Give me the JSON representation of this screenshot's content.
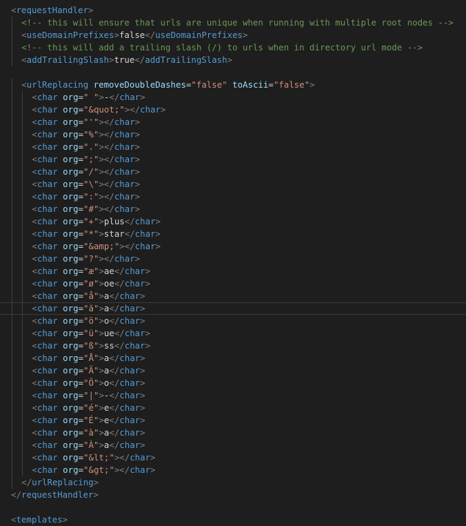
{
  "editor": {
    "theme_colors": {
      "background": "#1e1e1e",
      "tag": "#569cd6",
      "attribute": "#9cdcfe",
      "string": "#ce9178",
      "comment": "#6a9955",
      "text": "#d4d4d4",
      "bracket": "#808080"
    },
    "lines": [
      {
        "indent": 0,
        "type": "open",
        "tag": "requestHandler"
      },
      {
        "indent": 1,
        "type": "comment",
        "text": "<!-- this will ensure that urls are unique when running with multiple root nodes -->"
      },
      {
        "indent": 1,
        "type": "element",
        "tag": "useDomainPrefixes",
        "content": "false"
      },
      {
        "indent": 1,
        "type": "comment",
        "text": "<!-- this will add a trailing slash (/) to urls when in directory url mode -->"
      },
      {
        "indent": 1,
        "type": "element",
        "tag": "addTrailingSlash",
        "content": "true"
      },
      {
        "indent": 0,
        "type": "blank"
      },
      {
        "indent": 1,
        "type": "open",
        "tag": "urlReplacing",
        "attrs": [
          {
            "name": "removeDoubleDashes",
            "value": "false"
          },
          {
            "name": "toAscii",
            "value": "false"
          }
        ]
      },
      {
        "indent": 2,
        "type": "char",
        "org": " ",
        "content": "-"
      },
      {
        "indent": 2,
        "type": "char",
        "org": "&quot;",
        "content": ""
      },
      {
        "indent": 2,
        "type": "char",
        "org": "'",
        "content": ""
      },
      {
        "indent": 2,
        "type": "char",
        "org": "%",
        "content": ""
      },
      {
        "indent": 2,
        "type": "char",
        "org": ".",
        "content": ""
      },
      {
        "indent": 2,
        "type": "char",
        "org": ";",
        "content": ""
      },
      {
        "indent": 2,
        "type": "char",
        "org": "/",
        "content": ""
      },
      {
        "indent": 2,
        "type": "char",
        "org": "\\",
        "content": ""
      },
      {
        "indent": 2,
        "type": "char",
        "org": ":",
        "content": ""
      },
      {
        "indent": 2,
        "type": "char",
        "org": "#",
        "content": ""
      },
      {
        "indent": 2,
        "type": "char",
        "org": "+",
        "content": "plus"
      },
      {
        "indent": 2,
        "type": "char",
        "org": "*",
        "content": "star"
      },
      {
        "indent": 2,
        "type": "char",
        "org": "&amp;",
        "content": ""
      },
      {
        "indent": 2,
        "type": "char",
        "org": "?",
        "content": ""
      },
      {
        "indent": 2,
        "type": "char",
        "org": "æ",
        "content": "ae"
      },
      {
        "indent": 2,
        "type": "char",
        "org": "ø",
        "content": "oe"
      },
      {
        "indent": 2,
        "type": "char",
        "org": "å",
        "content": "a"
      },
      {
        "indent": 2,
        "type": "char",
        "org": "ä",
        "content": "a",
        "current": true
      },
      {
        "indent": 2,
        "type": "char",
        "org": "ö",
        "content": "o"
      },
      {
        "indent": 2,
        "type": "char",
        "org": "ü",
        "content": "ue"
      },
      {
        "indent": 2,
        "type": "char",
        "org": "ß",
        "content": "ss"
      },
      {
        "indent": 2,
        "type": "char",
        "org": "Å",
        "content": "a"
      },
      {
        "indent": 2,
        "type": "char",
        "org": "Ä",
        "content": "a"
      },
      {
        "indent": 2,
        "type": "char",
        "org": "Ö",
        "content": "o"
      },
      {
        "indent": 2,
        "type": "char",
        "org": "|",
        "content": "-"
      },
      {
        "indent": 2,
        "type": "char",
        "org": "é",
        "content": "e"
      },
      {
        "indent": 2,
        "type": "char",
        "org": "É",
        "content": "e"
      },
      {
        "indent": 2,
        "type": "char",
        "org": "à",
        "content": "a"
      },
      {
        "indent": 2,
        "type": "char",
        "org": "À",
        "content": "a"
      },
      {
        "indent": 2,
        "type": "char",
        "org": "&lt;",
        "content": ""
      },
      {
        "indent": 2,
        "type": "char",
        "org": "&gt;",
        "content": ""
      },
      {
        "indent": 1,
        "type": "close",
        "tag": "urlReplacing"
      },
      {
        "indent": 0,
        "type": "close",
        "tag": "requestHandler"
      },
      {
        "indent": 0,
        "type": "blank"
      },
      {
        "indent": 0,
        "type": "open",
        "tag": "templates"
      }
    ]
  }
}
